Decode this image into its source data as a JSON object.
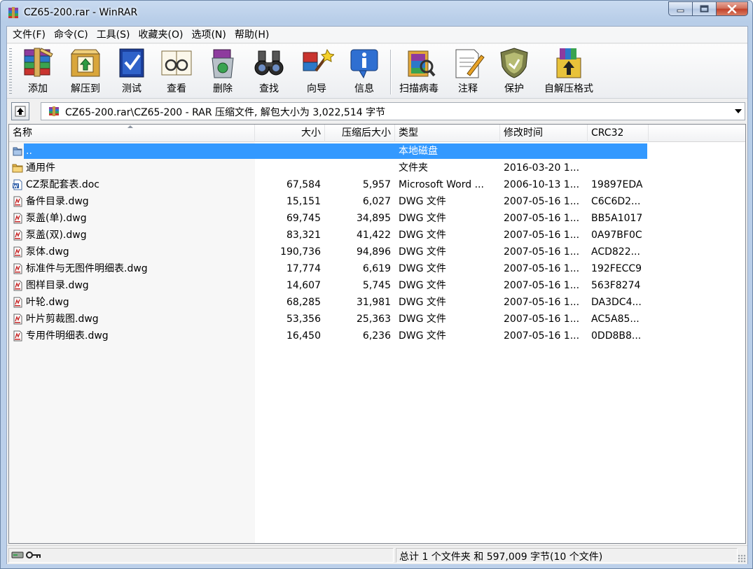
{
  "window": {
    "title": "CZ65-200.rar - WinRAR",
    "icon": "winrar-icon"
  },
  "menu": [
    {
      "id": "file",
      "label": "文件(F)"
    },
    {
      "id": "commands",
      "label": "命令(C)"
    },
    {
      "id": "tools",
      "label": "工具(S)"
    },
    {
      "id": "favorites",
      "label": "收藏夹(O)"
    },
    {
      "id": "options",
      "label": "选项(N)"
    },
    {
      "id": "help",
      "label": "帮助(H)"
    }
  ],
  "toolbar": [
    {
      "id": "add",
      "label": "添加",
      "icon": "add-archive-icon"
    },
    {
      "id": "extract",
      "label": "解压到",
      "icon": "extract-to-icon"
    },
    {
      "id": "test",
      "label": "测试",
      "icon": "test-icon"
    },
    {
      "id": "view",
      "label": "查看",
      "icon": "view-icon"
    },
    {
      "id": "delete",
      "label": "删除",
      "icon": "delete-icon"
    },
    {
      "id": "find",
      "label": "查找",
      "icon": "find-icon"
    },
    {
      "id": "wizard",
      "label": "向导",
      "icon": "wizard-icon"
    },
    {
      "id": "info",
      "label": "信息",
      "icon": "info-icon"
    },
    {
      "id": "virusscan",
      "label": "扫描病毒",
      "icon": "virus-scan-icon"
    },
    {
      "id": "comment",
      "label": "注释",
      "icon": "comment-icon"
    },
    {
      "id": "protect",
      "label": "保护",
      "icon": "protect-icon"
    },
    {
      "id": "sfx",
      "label": "自解压格式",
      "icon": "sfx-icon"
    }
  ],
  "address": {
    "path": "CZ65-200.rar\\CZ65-200 - RAR 压缩文件, 解包大小为 3,022,514 字节"
  },
  "columns": {
    "name": "名称",
    "size": "大小",
    "packed": "压缩后大小",
    "type": "类型",
    "modified": "修改时间",
    "crc": "CRC32"
  },
  "files": [
    {
      "name": "..",
      "size": "",
      "packed": "",
      "type": "本地磁盘",
      "modified": "",
      "crc": "",
      "icon": "parent-folder-icon",
      "selected": true
    },
    {
      "name": "通用件",
      "size": "",
      "packed": "",
      "type": "文件夹",
      "modified": "2016-03-20 1...",
      "crc": "",
      "icon": "folder-icon",
      "selected": false
    },
    {
      "name": "CZ泵配套表.doc",
      "size": "67,584",
      "packed": "5,957",
      "type": "Microsoft Word ...",
      "modified": "2006-10-13 1...",
      "crc": "19897EDA",
      "icon": "word-doc-icon",
      "selected": false
    },
    {
      "name": "备件目录.dwg",
      "size": "15,151",
      "packed": "6,027",
      "type": "DWG 文件",
      "modified": "2007-05-16 1...",
      "crc": "C6C6D2...",
      "icon": "dwg-file-icon",
      "selected": false
    },
    {
      "name": "泵盖(单).dwg",
      "size": "69,745",
      "packed": "34,895",
      "type": "DWG 文件",
      "modified": "2007-05-16 1...",
      "crc": "BB5A1017",
      "icon": "dwg-file-icon",
      "selected": false
    },
    {
      "name": "泵盖(双).dwg",
      "size": "83,321",
      "packed": "41,422",
      "type": "DWG 文件",
      "modified": "2007-05-16 1...",
      "crc": "0A97BF0C",
      "icon": "dwg-file-icon",
      "selected": false
    },
    {
      "name": "泵体.dwg",
      "size": "190,736",
      "packed": "94,896",
      "type": "DWG 文件",
      "modified": "2007-05-16 1...",
      "crc": "ACD822...",
      "icon": "dwg-file-icon",
      "selected": false
    },
    {
      "name": "标准件与无图件明细表.dwg",
      "size": "17,774",
      "packed": "6,619",
      "type": "DWG 文件",
      "modified": "2007-05-16 1...",
      "crc": "192FECC9",
      "icon": "dwg-file-icon",
      "selected": false
    },
    {
      "name": "图样目录.dwg",
      "size": "14,607",
      "packed": "5,745",
      "type": "DWG 文件",
      "modified": "2007-05-16 1...",
      "crc": "563F8274",
      "icon": "dwg-file-icon",
      "selected": false
    },
    {
      "name": "叶轮.dwg",
      "size": "68,285",
      "packed": "31,981",
      "type": "DWG 文件",
      "modified": "2007-05-16 1...",
      "crc": "DA3DC4...",
      "icon": "dwg-file-icon",
      "selected": false
    },
    {
      "name": "叶片剪裁图.dwg",
      "size": "53,356",
      "packed": "25,363",
      "type": "DWG 文件",
      "modified": "2007-05-16 1...",
      "crc": "AC5A85...",
      "icon": "dwg-file-icon",
      "selected": false
    },
    {
      "name": "专用件明细表.dwg",
      "size": "16,450",
      "packed": "6,236",
      "type": "DWG 文件",
      "modified": "2007-05-16 1...",
      "crc": "0DD8B8...",
      "icon": "dwg-file-icon",
      "selected": false
    }
  ],
  "status": {
    "summary": "总计 1 个文件夹 和 597,009 字节(10 个文件)"
  },
  "colors": {
    "selection": "#3399ff",
    "titlebar": "#c9daf0"
  }
}
